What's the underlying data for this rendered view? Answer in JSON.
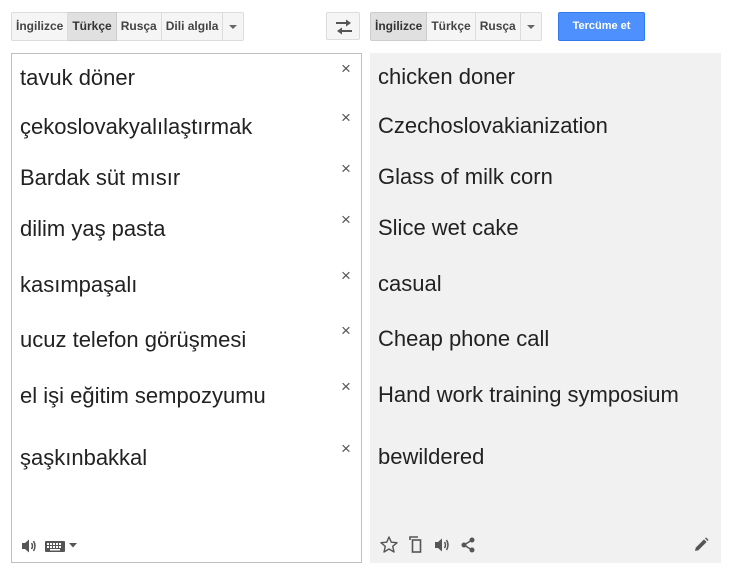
{
  "source_lang_bar": {
    "buttons": [
      "İngilizce",
      "Türkçe",
      "Rusça",
      "Dili algıla"
    ],
    "selected": "Türkçe"
  },
  "target_lang_bar": {
    "buttons": [
      "İngilizce",
      "Türkçe",
      "Rusça"
    ],
    "selected": "İngilizce"
  },
  "translate_button": {
    "label": "Tercüme et"
  },
  "colors": {
    "accent": "#4d90fe",
    "output_background": "#f1f1f1",
    "selected_lang": "#e0e0e0"
  },
  "source_entries": [
    "tavuk döner",
    "çekoslovakyalılaştırmak",
    "Bardak süt mısır",
    "dilim yaş pasta",
    "kasımpaşalı",
    "ucuz telefon görüşmesi",
    "el işi eğitim sempozyumu",
    "şaşkınbakkal"
  ],
  "translations": [
    "chicken doner",
    "Czechoslovakianization",
    "Glass of milk corn",
    "Slice wet cake",
    "casual",
    "Cheap phone call",
    "Hand work training symposium",
    "bewildered"
  ],
  "clear_glyph": "×",
  "icons": {
    "swap": "swap-arrows-icon",
    "source_toolbar": [
      "speaker-icon",
      "keyboard-icon",
      "dropdown-caret-icon"
    ],
    "output_toolbar": [
      "star-icon",
      "copy-icon",
      "speaker-icon",
      "share-icon",
      "pencil-icon"
    ]
  }
}
